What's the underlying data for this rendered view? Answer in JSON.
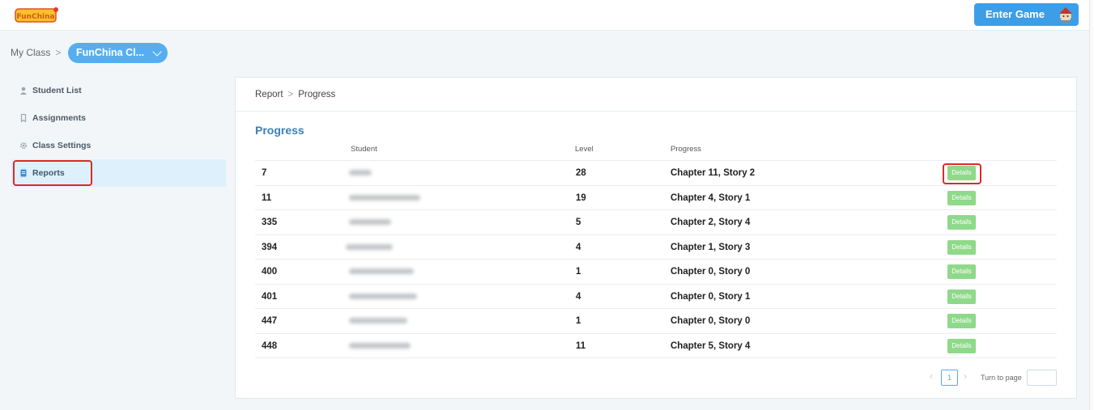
{
  "header": {
    "logo_text": "FunChina",
    "enter_game_label": "Enter Game"
  },
  "breadcrumb": {
    "root": "My Class",
    "separator": ">",
    "class_name": "FunChina Cl..."
  },
  "sidebar": {
    "items": [
      {
        "label": "Student List",
        "icon": "user-icon"
      },
      {
        "label": "Assignments",
        "icon": "bookmark-icon"
      },
      {
        "label": "Class Settings",
        "icon": "gear-icon"
      },
      {
        "label": "Reports",
        "icon": "report-icon",
        "active": true
      }
    ]
  },
  "panel": {
    "crumb_root": "Report",
    "crumb_separator": ">",
    "crumb_current": "Progress",
    "title": "Progress"
  },
  "table": {
    "columns": [
      "Student",
      "Level",
      "Progress"
    ],
    "rows": [
      {
        "id": "7",
        "level": "28",
        "progress": "Chapter 11, Story 2",
        "action": "Details"
      },
      {
        "id": "11",
        "level": "19",
        "progress": "Chapter 4, Story 1",
        "action": "Details"
      },
      {
        "id": "335",
        "level": "5",
        "progress": "Chapter 2, Story 4",
        "action": "Details"
      },
      {
        "id": "394",
        "level": "4",
        "progress": "Chapter 1, Story 3",
        "action": "Details"
      },
      {
        "id": "400",
        "level": "1",
        "progress": "Chapter 0, Story 0",
        "action": "Details"
      },
      {
        "id": "401",
        "level": "4",
        "progress": "Chapter 0, Story 1",
        "action": "Details"
      },
      {
        "id": "447",
        "level": "1",
        "progress": "Chapter 0, Story 0",
        "action": "Details"
      },
      {
        "id": "448",
        "level": "11",
        "progress": "Chapter 5, Story 4",
        "action": "Details"
      }
    ]
  },
  "pagination": {
    "current_page": "1",
    "turn_to_page_label": "Turn to page"
  },
  "colors": {
    "accent": "#3d9ee8",
    "details_button": "#8fd98a",
    "highlight": "#e02828"
  }
}
